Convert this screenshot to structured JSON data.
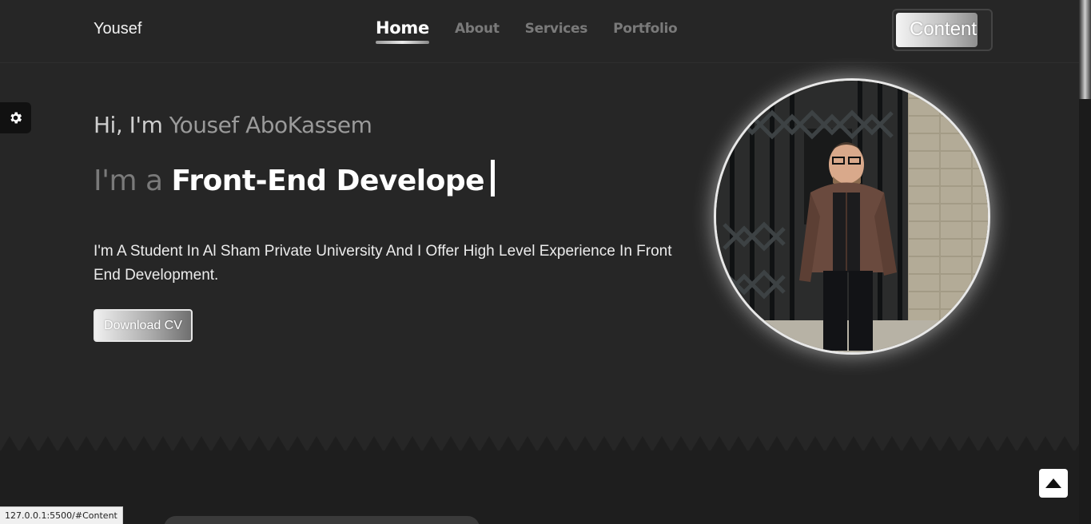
{
  "header": {
    "brand": "Yousef",
    "nav": [
      {
        "label": "Home",
        "active": true
      },
      {
        "label": "About",
        "active": false
      },
      {
        "label": "Services",
        "active": false
      },
      {
        "label": "Portfolio",
        "active": false
      }
    ],
    "content_button": "Content"
  },
  "hero": {
    "greeting_start": "Hi, I'm ",
    "greeting_end": "Yousef AboKassem",
    "role_prefix": "I'm a ",
    "role_typed": "Front-End Develope",
    "bio": "I'm A Student In Al Sham Private University And I Offer High Level Experience In Front End Development.",
    "cv_button": "Download CV"
  },
  "icons": {
    "settings": "gear-icon",
    "back_to_top": "caret-up-icon"
  },
  "status_bar": {
    "url": "127.0.0.1:5500/#Content"
  },
  "colors": {
    "background": "#262626",
    "lower_background": "#1e1e1e",
    "accent_text": "#ffffff",
    "muted_text": "#7a7a7a"
  }
}
